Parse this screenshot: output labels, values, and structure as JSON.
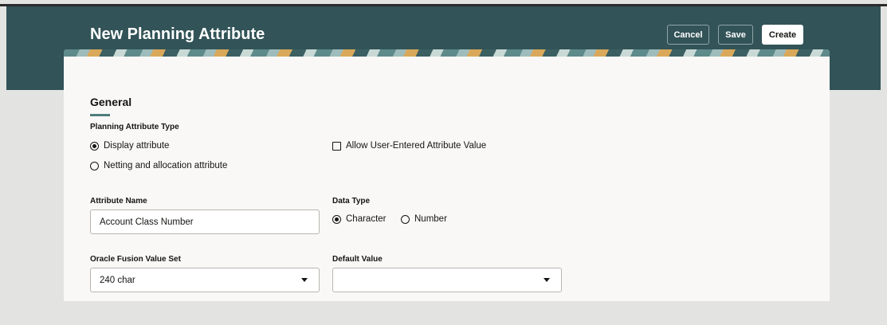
{
  "header": {
    "title": "New Planning Attribute",
    "cancel": "Cancel",
    "save": "Save",
    "create": "Create"
  },
  "section": {
    "title": "General"
  },
  "attribute_type": {
    "label": "Planning Attribute Type",
    "options": [
      "Display attribute",
      "Netting and allocation attribute"
    ],
    "selected": "Display attribute"
  },
  "allow_user": {
    "label": "Allow User-Entered Attribute Value",
    "checked": false
  },
  "attribute_name": {
    "label": "Attribute Name",
    "value": "Account Class Number"
  },
  "data_type": {
    "label": "Data Type",
    "options": [
      "Character",
      "Number"
    ],
    "selected": "Character"
  },
  "value_set": {
    "label": "Oracle Fusion Value Set",
    "value": "240 char"
  },
  "default_value": {
    "label": "Default Value",
    "value": ""
  }
}
